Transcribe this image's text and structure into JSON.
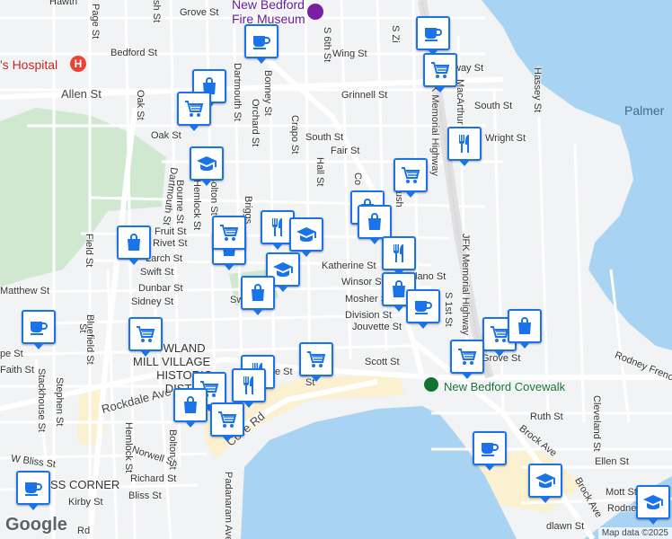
{
  "map": {
    "water_labels": {
      "palmer": "Palmer"
    },
    "pois": {
      "hospital": "'s Hospital",
      "museum": "New Bedford Fire Museum",
      "covewalk": "New Bedford Covewalk",
      "historic_district": [
        "WLAND",
        "MILL VILLAGE",
        "HISTORIC",
        "DISTRI"
      ],
      "corner": "SS CORNER"
    },
    "streets": {
      "hawth": "Hawth",
      "grove_top": "Grove St",
      "page": "Page St",
      "ash": "sh St",
      "bedford": "Bedford St",
      "allen": "Allen St",
      "oak": "Oak St",
      "oak2": "Oak St",
      "wing": "Wing St",
      "dartmouth_top": "Dartmouth St",
      "bonney": "Bonney St",
      "orchard": "Orchard St",
      "s6th": "S 6th St",
      "grinnell": "Grinnell St",
      "crapo": "Crapo St",
      "south": "South St",
      "south_e": "South St",
      "fair": "Fair St",
      "wright": "Wright St",
      "hall": "Hall St",
      "way": "way St",
      "hassey": "Hassey St",
      "macarthur": "MacArthur",
      "jfk_top": "K Memorial Highway",
      "szion": "S Zi",
      "dartmouth_left": "Dartmouth St",
      "bourne": "Bourne St",
      "hemlock": "Hemlock St",
      "bolton": "Bolton St",
      "briggs": "Briggs",
      "fruit": "Fruit St",
      "rivet": "Rivet St",
      "larch": "Larch St",
      "swift": "Swift St",
      "dunbar": "Dunbar St",
      "sidney": "Sidney St",
      "matthew": "Matthew St",
      "field": "Field St",
      "katherine": "Katherine St",
      "winsor": "Winsor St",
      "mosher": "Mosher St",
      "division": "Division St",
      "jouvette": "Jouvette St",
      "delano": "lano St",
      "s1st": "S 1st St",
      "jfk_right": "JFK Memorial Highway",
      "acush": "Acush",
      "co": "Co",
      "scott": "Scott St",
      "grove_right": "Grove St",
      "rodney_french": "Rodney French",
      "faith": "Faith St",
      "pe": "pe St",
      "stackhouse": "Stackhouse St",
      "stephen": "Stephen St",
      "bluefield": "Bluefield St",
      "st_small": "St",
      "rockdale": "Rockdale Ave",
      "hemlock_s": "Hemlock St",
      "norwell": "Norwell St",
      "bolton_s": "Bolton St",
      "richard": "Richard St",
      "bliss": "Bliss St",
      "wbliss": "W Bliss St",
      "kirby": "Kirby St",
      "cove": "Cove Rd",
      "padanaram": "Padanaram Ave",
      "ruth": "Ruth St",
      "cleveland": "Cleveland St",
      "brock": "Brock Ave",
      "ellen": "Ellen St",
      "brock2": "Brock Ave",
      "mott": "Mott St",
      "rodney_s": "Rodney",
      "dlawn": "dlawn St",
      "e_st": "e St",
      "sw": "Sw",
      "rd": "Rd",
      "st_dot": "St"
    },
    "pins": [
      {
        "id": "cafe-1",
        "type": "cafe-icon"
      },
      {
        "id": "cafe-2",
        "type": "cafe-icon"
      },
      {
        "id": "shop-1",
        "type": "shopping-bag-icon"
      },
      {
        "id": "cart-1",
        "type": "shopping-cart-icon"
      },
      {
        "id": "school-1",
        "type": "school-icon"
      },
      {
        "id": "restaurant-1",
        "type": "restaurant-icon"
      },
      {
        "id": "cart-2",
        "type": "shopping-cart-icon"
      },
      {
        "id": "cart-3",
        "type": "shopping-cart-icon"
      },
      {
        "id": "shop-2",
        "type": "shopping-bag-icon"
      },
      {
        "id": "shop-3",
        "type": "shopping-bag-icon"
      },
      {
        "id": "restaurant-2",
        "type": "restaurant-icon"
      },
      {
        "id": "school-2",
        "type": "school-icon"
      },
      {
        "id": "school-3",
        "type": "school-icon"
      },
      {
        "id": "shop-4",
        "type": "shopping-bag-icon"
      },
      {
        "id": "shop-5",
        "type": "shopping-bag-icon"
      },
      {
        "id": "shop-6",
        "type": "shopping-bag-icon"
      },
      {
        "id": "restaurant-3",
        "type": "restaurant-icon"
      },
      {
        "id": "shop-7",
        "type": "shopping-bag-icon"
      },
      {
        "id": "cafe-3",
        "type": "cafe-icon"
      },
      {
        "id": "cafe-4",
        "type": "cafe-icon"
      },
      {
        "id": "cart-4",
        "type": "shopping-cart-icon"
      },
      {
        "id": "cart-5",
        "type": "shopping-cart-icon"
      },
      {
        "id": "restaurant-4",
        "type": "restaurant-icon"
      },
      {
        "id": "restaurant-5",
        "type": "restaurant-icon"
      },
      {
        "id": "cart-6",
        "type": "shopping-cart-icon"
      },
      {
        "id": "shop-8",
        "type": "shopping-bag-icon"
      },
      {
        "id": "cart-7",
        "type": "shopping-cart-icon"
      },
      {
        "id": "cart-8",
        "type": "shopping-cart-icon"
      },
      {
        "id": "shop-9",
        "type": "shopping-bag-icon"
      },
      {
        "id": "cart-9",
        "type": "shopping-cart-icon"
      },
      {
        "id": "cafe-5",
        "type": "cafe-icon"
      },
      {
        "id": "school-4",
        "type": "school-icon"
      },
      {
        "id": "cafe-6",
        "type": "cafe-icon"
      },
      {
        "id": "school-5",
        "type": "school-icon"
      },
      {
        "id": "cart-10",
        "type": "shopping-cart-icon"
      }
    ],
    "branding": {
      "logo": "Google",
      "attribution": "Map data ©2025"
    },
    "colors": {
      "water": "#a9d3f2",
      "park": "#cfe8cf",
      "sand": "#fbf1d0",
      "road": "#ffffff",
      "highway": "#e8e8e8",
      "pin_border": "#1a73e8"
    }
  }
}
